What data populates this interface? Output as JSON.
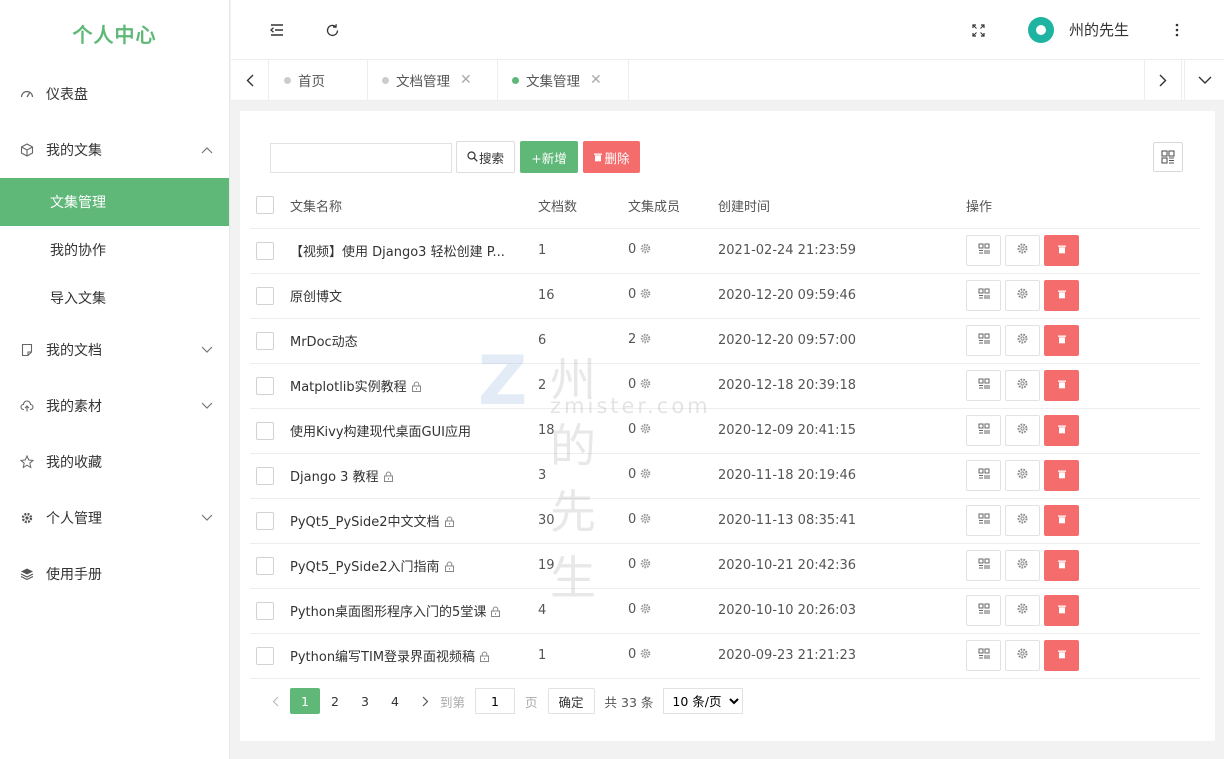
{
  "app": {
    "title": "个人中心"
  },
  "sidebar": {
    "items": [
      {
        "label": "仪表盘",
        "icon": "dashboard-icon"
      },
      {
        "label": "我的文集",
        "icon": "cube-icon",
        "expanded": true,
        "children": [
          {
            "label": "文集管理",
            "active": true
          },
          {
            "label": "我的协作"
          },
          {
            "label": "导入文集"
          }
        ]
      },
      {
        "label": "我的文档",
        "icon": "document-icon"
      },
      {
        "label": "我的素材",
        "icon": "cloud-upload-icon"
      },
      {
        "label": "我的收藏",
        "icon": "star-icon"
      },
      {
        "label": "个人管理",
        "icon": "gear-icon"
      },
      {
        "label": "使用手册",
        "icon": "layers-icon"
      }
    ]
  },
  "header": {
    "user_name": "州的先生"
  },
  "tabs": [
    {
      "label": "首页",
      "closable": false,
      "active": false
    },
    {
      "label": "文档管理",
      "closable": true,
      "active": false
    },
    {
      "label": "文集管理",
      "closable": true,
      "active": true
    }
  ],
  "toolbar": {
    "search_placeholder": "",
    "search_label": "搜索",
    "add_label": "+新增",
    "delete_label": "删除"
  },
  "table": {
    "headers": [
      "文集名称",
      "文档数",
      "文集成员",
      "创建时间",
      "操作"
    ],
    "rows": [
      {
        "name": "【视频】使用 Django3 轻松创建 P...",
        "docs": "1",
        "members": "0",
        "created": "2021-02-24 21:23:59",
        "locked": false
      },
      {
        "name": "原创博文",
        "docs": "16",
        "members": "0",
        "created": "2020-12-20 09:59:46",
        "locked": false
      },
      {
        "name": "MrDoc动态",
        "docs": "6",
        "members": "2",
        "created": "2020-12-20 09:57:00",
        "locked": false
      },
      {
        "name": "Matplotlib实例教程",
        "docs": "2",
        "members": "0",
        "created": "2020-12-18 20:39:18",
        "locked": true
      },
      {
        "name": "使用Kivy构建现代桌面GUI应用",
        "docs": "18",
        "members": "0",
        "created": "2020-12-09 20:41:15",
        "locked": false
      },
      {
        "name": "Django 3 教程",
        "docs": "3",
        "members": "0",
        "created": "2020-11-18 20:19:46",
        "locked": true
      },
      {
        "name": "PyQt5_PySide2中文文档",
        "docs": "30",
        "members": "0",
        "created": "2020-11-13 08:35:41",
        "locked": true
      },
      {
        "name": "PyQt5_PySide2入门指南",
        "docs": "19",
        "members": "0",
        "created": "2020-10-21 20:42:36",
        "locked": true
      },
      {
        "name": "Python桌面图形程序入门的5堂课",
        "docs": "4",
        "members": "0",
        "created": "2020-10-10 20:26:03",
        "locked": true
      },
      {
        "name": "Python编写TIM登录界面视频稿",
        "docs": "1",
        "members": "0",
        "created": "2020-09-23 21:21:23",
        "locked": true
      }
    ]
  },
  "pagination": {
    "pages": [
      "1",
      "2",
      "3",
      "4"
    ],
    "current": "1",
    "goto_prefix": "到第",
    "goto_value": "1",
    "goto_suffix": "页",
    "confirm_label": "确定",
    "total_text": "共 33 条",
    "page_size": "10 条/页"
  },
  "watermark": {
    "letter": "Z",
    "cn": "州的先生",
    "en": "zmister.com"
  },
  "colors": {
    "accent": "#5fb878",
    "danger": "#f56c6c",
    "avatar": "#1fb3a2"
  }
}
